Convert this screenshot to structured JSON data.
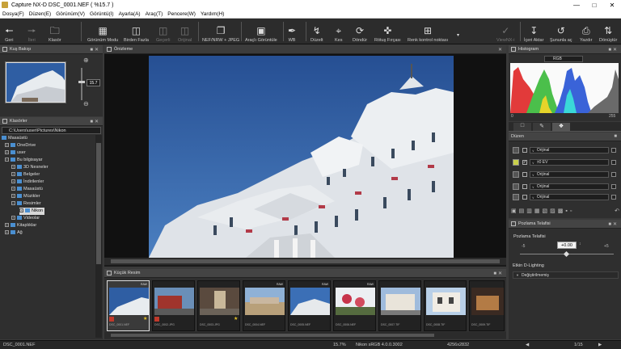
{
  "window": {
    "title": "Capture NX-D    DSC_0001.NEF ( %15.7 )"
  },
  "menu": [
    "Dosya(F)",
    "Düzen(E)",
    "Görünüm(V)",
    "Görüntü(I)",
    "Ayarla(A)",
    "Araç(T)",
    "Pencere(W)",
    "Yardım(H)"
  ],
  "toolbar": {
    "back": "Geri",
    "forward": "İleri",
    "folder": "Klasör",
    "view_mode": "Görünüm Modu",
    "compare": "Birden Fazla",
    "prev": "Geçerli",
    "original": "Orijinal",
    "nefjpeg": "NEF/NRW + JPEG",
    "tool_view": "Araçlı Görüntüle",
    "wb": "WB",
    "straighten": "Düzelt",
    "crop": "Kes",
    "rotate": "Döndür",
    "retouch": "Rötuş Fırçası",
    "color_control": "Renk kontrol noktası",
    "viewnx": "ViewNX-i",
    "transfer": "İçeri Aktar",
    "open_with": "Şununla aç",
    "print": "Yazdır",
    "convert": "Dönüştür"
  },
  "birdseye": {
    "title": "Kuş Bakışı",
    "zoom": "15.7"
  },
  "folders": {
    "title": "Klasörler",
    "path": "C:\\Users\\user\\Pictures\\Nikon",
    "items": [
      "Masaüstü",
      "OneDrive",
      "user",
      "Bu bilgisayar",
      "3D Nesneler",
      "Belgeler",
      "İndirilenler",
      "Masaüstü",
      "Müzikler",
      "Resimler",
      "Nikon",
      "Videolar",
      "Kitaplıklar",
      "Ağ"
    ]
  },
  "viewer": {
    "title": "Önizleme"
  },
  "thumbs": {
    "title": "Küçük Resim",
    "items": [
      {
        "raw": "RAW",
        "cap": "DSC_0001.NEF"
      },
      {
        "raw": "",
        "cap": "DSC_0002.JPG"
      },
      {
        "raw": "",
        "cap": "DSC_0003.JPG"
      },
      {
        "raw": "RAW",
        "cap": "DSC_0004.NEF"
      },
      {
        "raw": "RAW",
        "cap": "DSC_0005.NEF"
      },
      {
        "raw": "RAW",
        "cap": "DSC_0006.NEF"
      },
      {
        "raw": "",
        "cap": "DSC_0007.TIF"
      },
      {
        "raw": "",
        "cap": "DSC_0008.TIF"
      },
      {
        "raw": "",
        "cap": "DSC_0009.TIF"
      }
    ]
  },
  "histogram": {
    "title": "Histogram",
    "channel": "RGB",
    "min": "0",
    "max": "255"
  },
  "adjust": {
    "title": "Düzen",
    "rows": [
      "Orijinal",
      "±0 EV",
      "Orijinal",
      "Orijinal",
      "Orijinal"
    ]
  },
  "exposure": {
    "title": "Pozlama Telafisi",
    "label": "Pozlama Telafisi",
    "value": "+0.00",
    "min": "-5",
    "max": "+5",
    "dlighting": "Etkin D-Lighting",
    "dlighting_value": "Değiştirilmemiş"
  },
  "status": {
    "file": "DSC_0001.NEF",
    "zoom": "15.7%",
    "info": "Nikon sRGB 4.0.0.3002",
    "dims": "4256x2832",
    "page": "1/15"
  }
}
